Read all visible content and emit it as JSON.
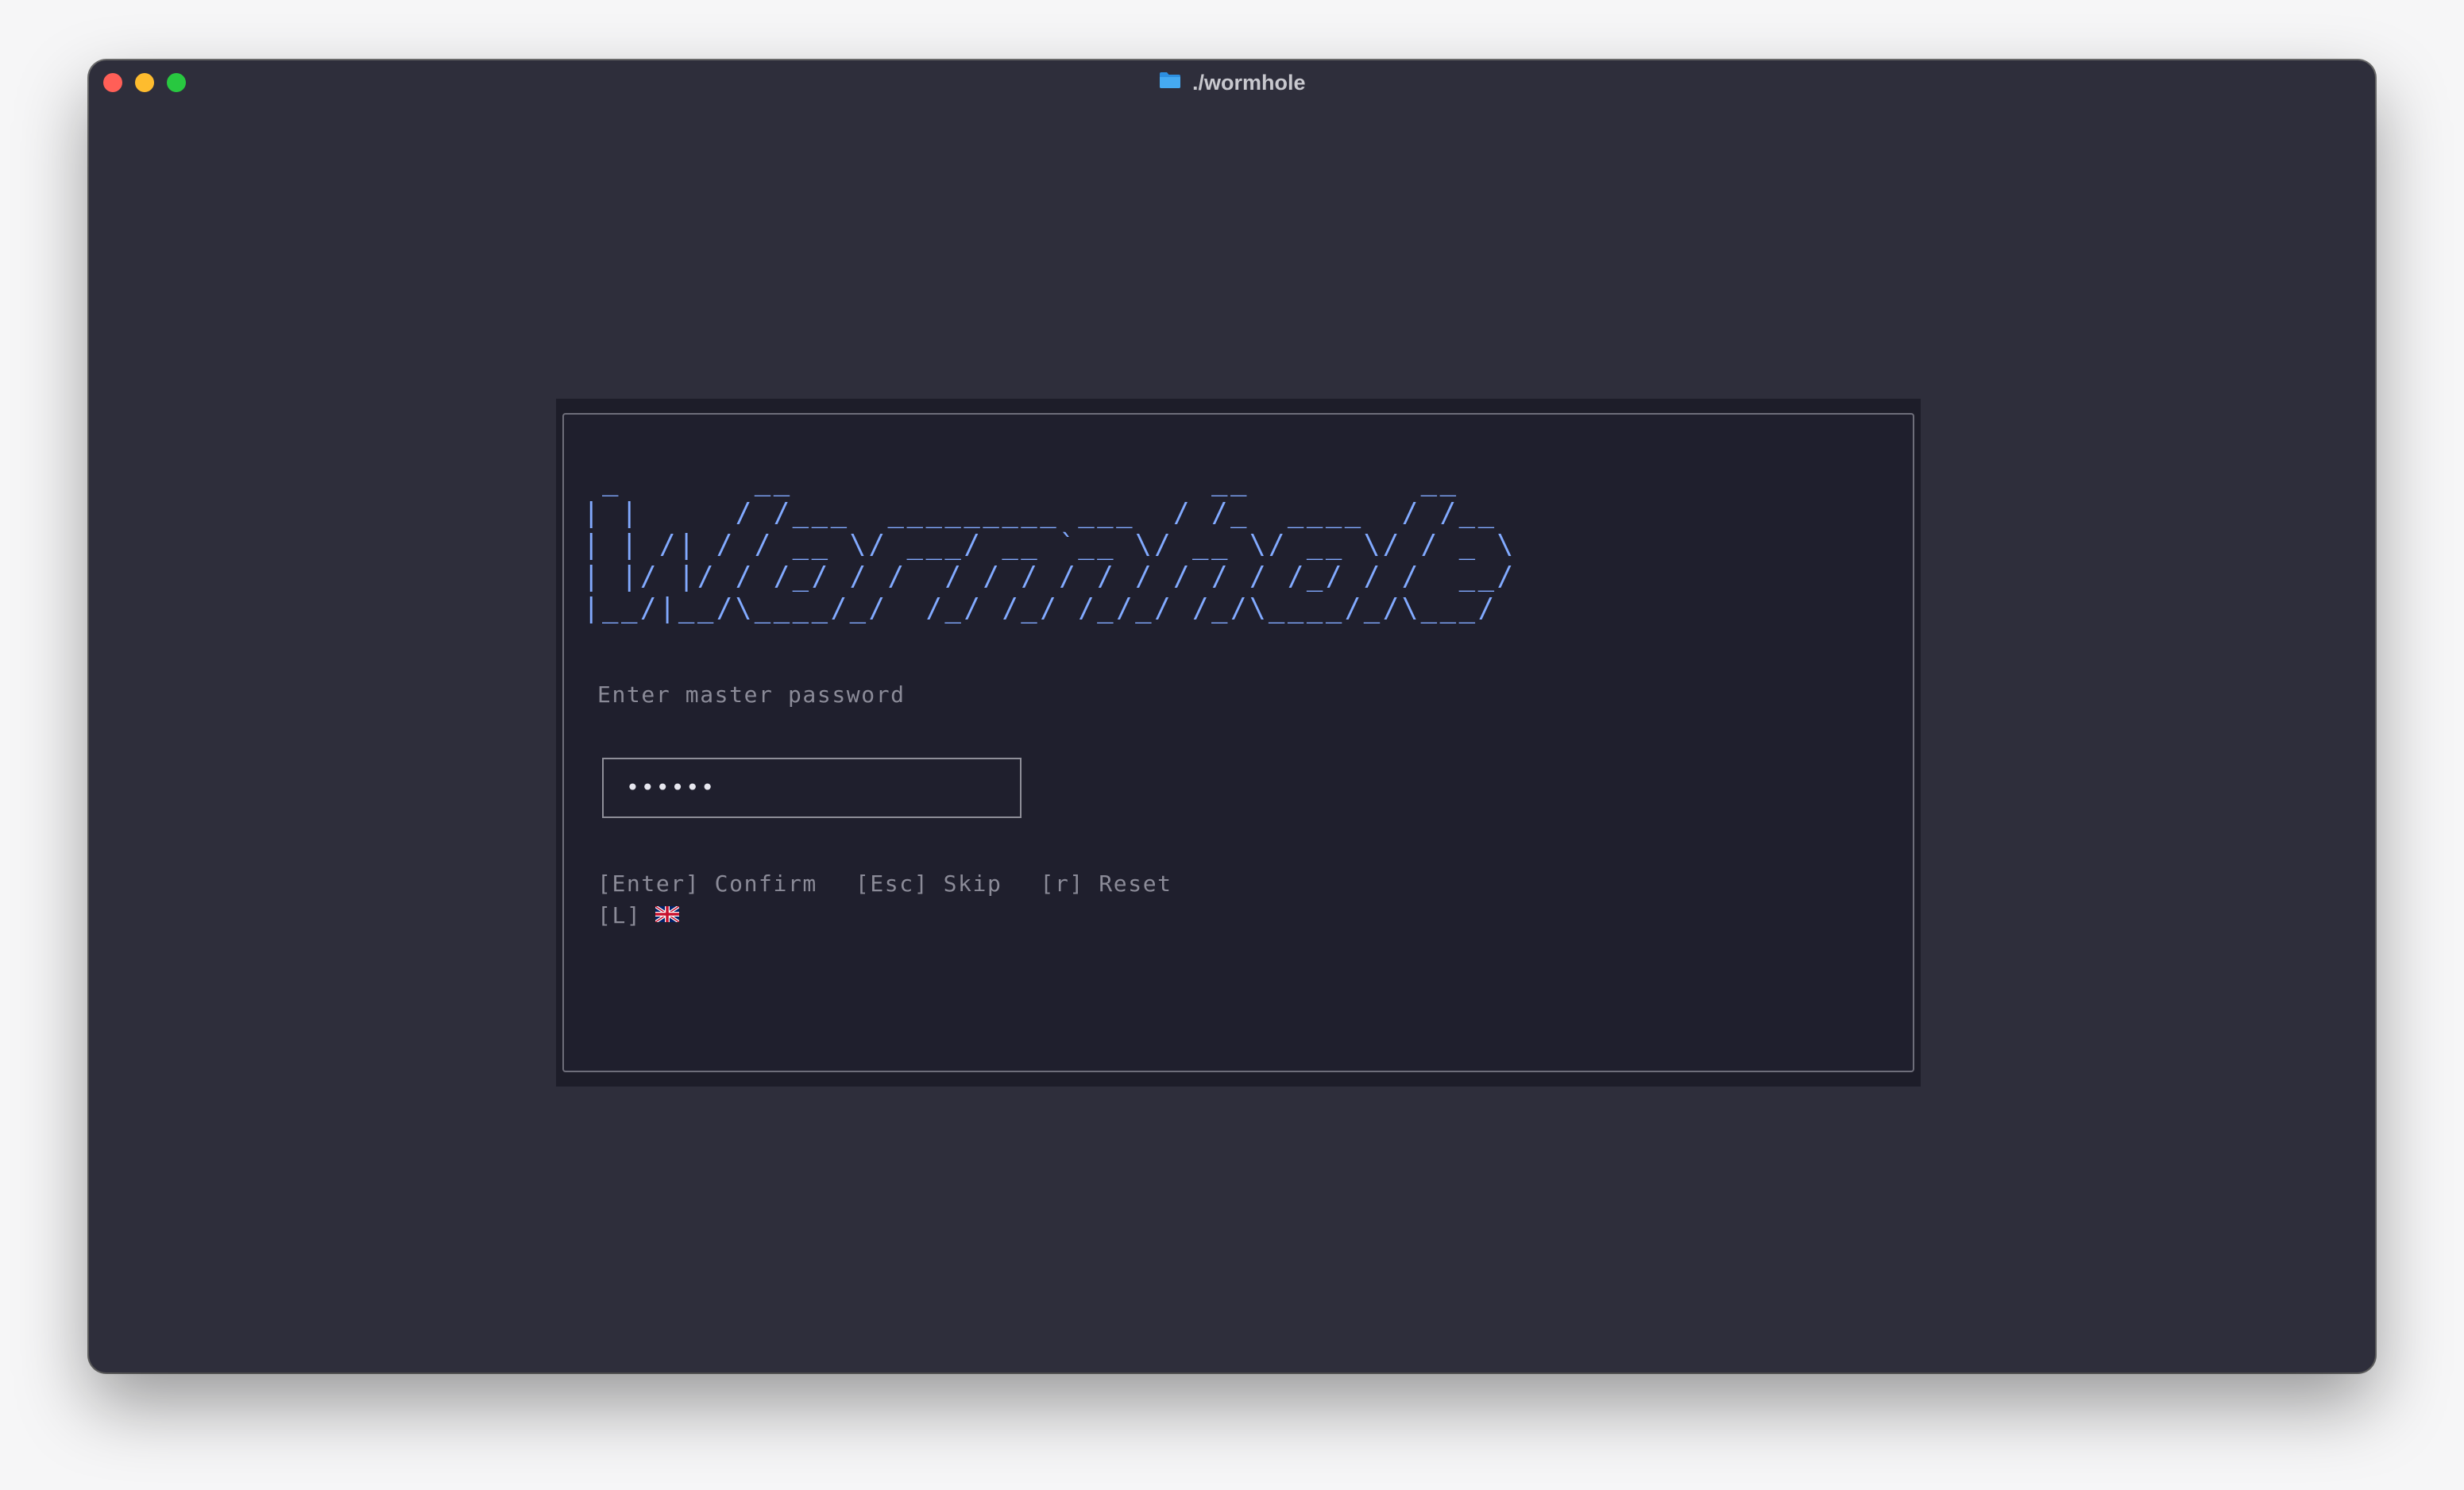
{
  "window": {
    "title": "./wormhole",
    "title_icon": "folder-icon",
    "controls": [
      "close",
      "minimize",
      "maximize"
    ]
  },
  "banner": {
    "text": "Wormhole",
    "ascii": " _       __                      __         __\n| |     / /___  _________ ___  / /_  ____  / /__\n| | /| / / __ \\/ ___/ __ `__ \\/ __ \\/ __ \\/ / _ \\\n| |/ |/ / /_/ / /  / / / / / / / / / /_/ / /  __/\n|__/|__/\\____/_/  /_/ /_/ /_/_/ /_/\\____/_/\\___/",
    "color": "#82aaff"
  },
  "login": {
    "prompt": "Enter master password",
    "password_masked": "••••••"
  },
  "keyhints": [
    {
      "key": "[Enter]",
      "label": "Confirm"
    },
    {
      "key": "[Esc]",
      "label": "Skip"
    },
    {
      "key": "[r]",
      "label": "Reset"
    }
  ],
  "language": {
    "key": "[L]",
    "flag_icon": "uk-flag-icon"
  },
  "colors": {
    "window_bg": "#2e2e3b",
    "panel_bg": "#1f1f2d",
    "muted_text": "#8b8b98",
    "accent": "#82aaff"
  }
}
